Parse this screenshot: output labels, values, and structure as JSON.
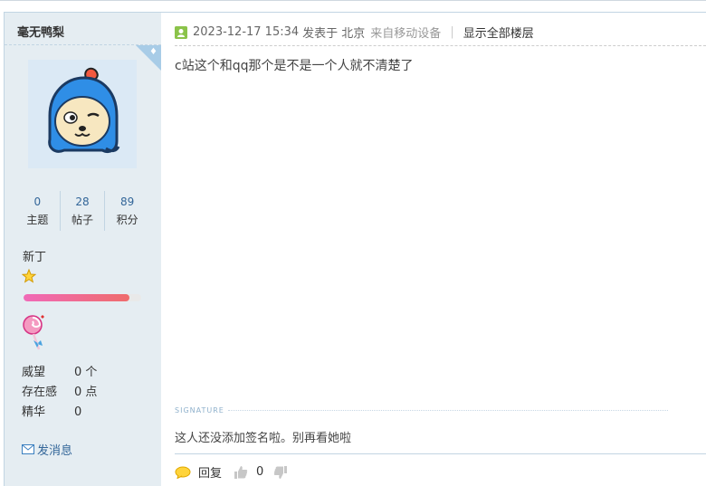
{
  "user": {
    "name": "毫无鸭梨",
    "stats": [
      {
        "num": "0",
        "label": "主题"
      },
      {
        "num": "28",
        "label": "帖子"
      },
      {
        "num": "89",
        "label": "积分"
      }
    ],
    "rank": "新丁",
    "progress": 0.9,
    "profile": [
      {
        "k": "威望",
        "v": "0 个"
      },
      {
        "k": "存在感",
        "v": "0 点"
      },
      {
        "k": "精华",
        "v": "0"
      }
    ],
    "pm_label": "发消息"
  },
  "post": {
    "timestamp": "2023-12-17 15:34",
    "posted_in": "发表于 北京",
    "device": "来自移动设备",
    "separator": "|",
    "show_all": "显示全部楼层",
    "content": "c站这个和qq那个是不是一个人就不清楚了",
    "signature_label": "SIGNATURE",
    "signature": "这人还没添加签名啦。别再看她啦"
  },
  "actions": {
    "reply": "回复",
    "likes": "0"
  },
  "colors": {
    "sidebar_bg": "#e5edf2",
    "link": "#336699",
    "online": "#8bc34a",
    "avatar_blue": "#2f8ee6"
  }
}
